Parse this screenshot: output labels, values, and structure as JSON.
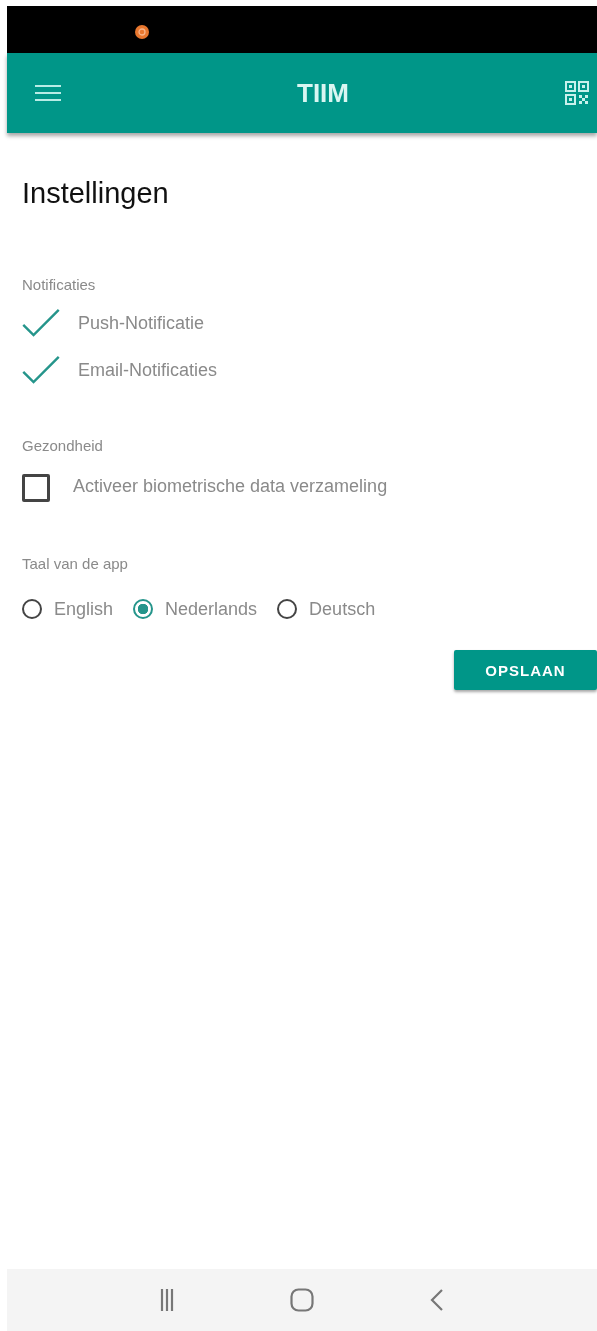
{
  "app_bar": {
    "title": "TIIM"
  },
  "page_title": "Instellingen",
  "sections": [
    {
      "heading": "Notificaties",
      "items": [
        {
          "kind": "tick",
          "label": "Push-Notificatie",
          "checked": true
        },
        {
          "kind": "tick",
          "label": "Email-Notificaties",
          "checked": true
        }
      ]
    },
    {
      "heading": "Gezondheid",
      "items": [
        {
          "kind": "checkbox",
          "label": "Activeer biometrische data verzameling",
          "checked": false
        }
      ]
    },
    {
      "heading": "Taal van de app",
      "items": [
        {
          "kind": "radio",
          "label": "English",
          "selected": false
        },
        {
          "kind": "radio",
          "label": "Nederlands",
          "selected": true
        },
        {
          "kind": "radio",
          "label": "Deutsch",
          "selected": false
        }
      ]
    }
  ],
  "save_button": "OPSLAAN"
}
